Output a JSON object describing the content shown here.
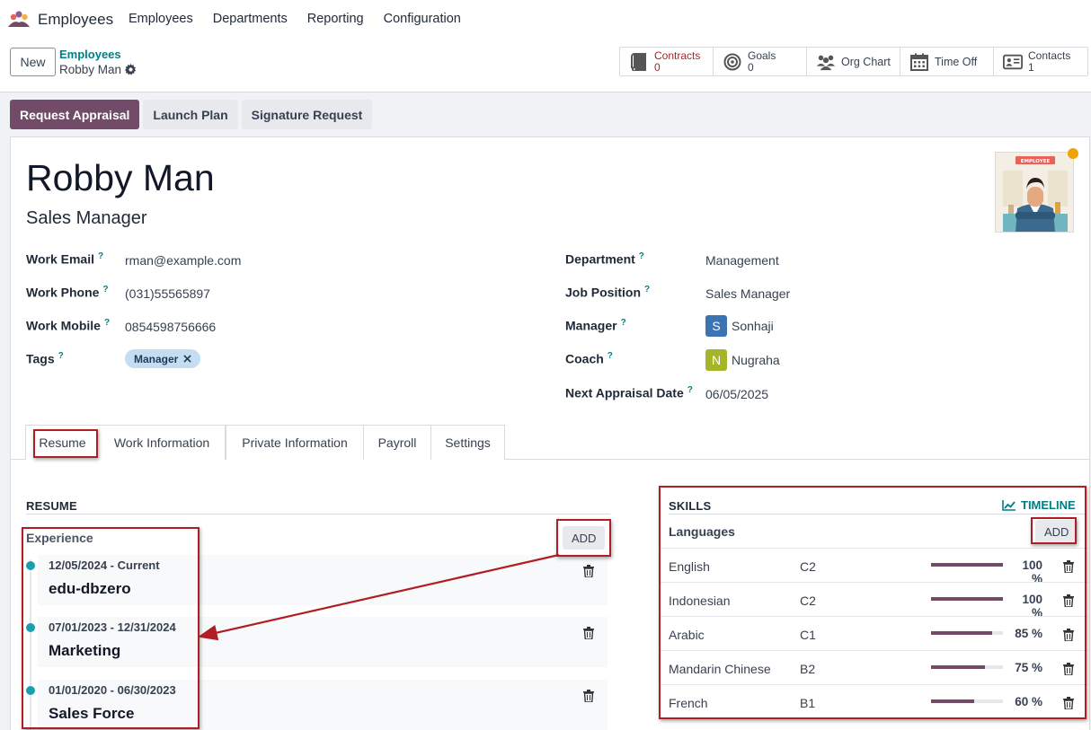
{
  "app": {
    "name": "Employees",
    "menu": [
      "Employees",
      "Departments",
      "Reporting",
      "Configuration"
    ]
  },
  "control_panel": {
    "new_label": "New",
    "breadcrumb_parent": "Employees",
    "breadcrumb_current": "Robby Man",
    "smart_buttons": [
      {
        "label": "Contracts",
        "count": "0",
        "icon": "book-icon",
        "color": "#a12a2a"
      },
      {
        "label": "Goals",
        "count": "0",
        "icon": "target-icon"
      },
      {
        "label": "Org Chart",
        "count": "",
        "icon": "users-icon"
      },
      {
        "label": "Time Off",
        "count": "",
        "icon": "calendar-icon"
      },
      {
        "label": "Contacts",
        "count": "1",
        "icon": "contact-card-icon"
      }
    ]
  },
  "actions": {
    "request_appraisal": "Request Appraisal",
    "launch_plan": "Launch Plan",
    "signature_request": "Signature Request"
  },
  "employee": {
    "name": "Robby Man",
    "job_title": "Sales Manager",
    "avatar_caption": "EMPLOYEE",
    "status_color": "#f0a20a"
  },
  "fields_left": {
    "work_email_label": "Work Email",
    "work_email": "rman@example.com",
    "work_phone_label": "Work Phone",
    "work_phone": "(031)55565897",
    "work_mobile_label": "Work Mobile",
    "work_mobile": "0854598756666",
    "tags_label": "Tags",
    "tag": "Manager"
  },
  "fields_right": {
    "department_label": "Department",
    "department": "Management",
    "job_position_label": "Job Position",
    "job_position": "Sales Manager",
    "manager_label": "Manager",
    "manager_initial": "S",
    "manager": "Sonhaji",
    "coach_label": "Coach",
    "coach_initial": "N",
    "coach": "Nugraha",
    "next_appraisal_label": "Next Appraisal Date",
    "next_appraisal": "06/05/2025"
  },
  "help_mark": "?",
  "tabs": [
    "Resume",
    "Work Information",
    "Private Information",
    "Payroll",
    "Settings"
  ],
  "resume": {
    "title": "RESUME",
    "section_label": "Experience",
    "add_label": "ADD",
    "items": [
      {
        "dates": "12/05/2024 - Current",
        "title": "edu-dbzero"
      },
      {
        "dates": "07/01/2023 - 12/31/2024",
        "title": "Marketing"
      },
      {
        "dates": "01/01/2020 - 06/30/2023",
        "title": "Sales Force"
      }
    ]
  },
  "skills": {
    "title": "SKILLS",
    "timeline_label": "TIMELINE",
    "group_label": "Languages",
    "add_label": "ADD",
    "items": [
      {
        "name": "English",
        "level": "C2",
        "progress": 100,
        "pct_label": "100 %"
      },
      {
        "name": "Indonesian",
        "level": "C2",
        "progress": 100,
        "pct_label": "100 %"
      },
      {
        "name": "Arabic",
        "level": "C1",
        "progress": 85,
        "pct_label": "85 %"
      },
      {
        "name": "Mandarin Chinese",
        "level": "B2",
        "progress": 75,
        "pct_label": "75 %"
      },
      {
        "name": "French",
        "level": "B1",
        "progress": 60,
        "pct_label": "60 %"
      }
    ]
  },
  "colors": {
    "primary": "#714b67",
    "accent": "#017e84",
    "annotation": "#b01e23",
    "manager_avatar": "#3b73b3",
    "coach_avatar": "#a6b42a"
  }
}
